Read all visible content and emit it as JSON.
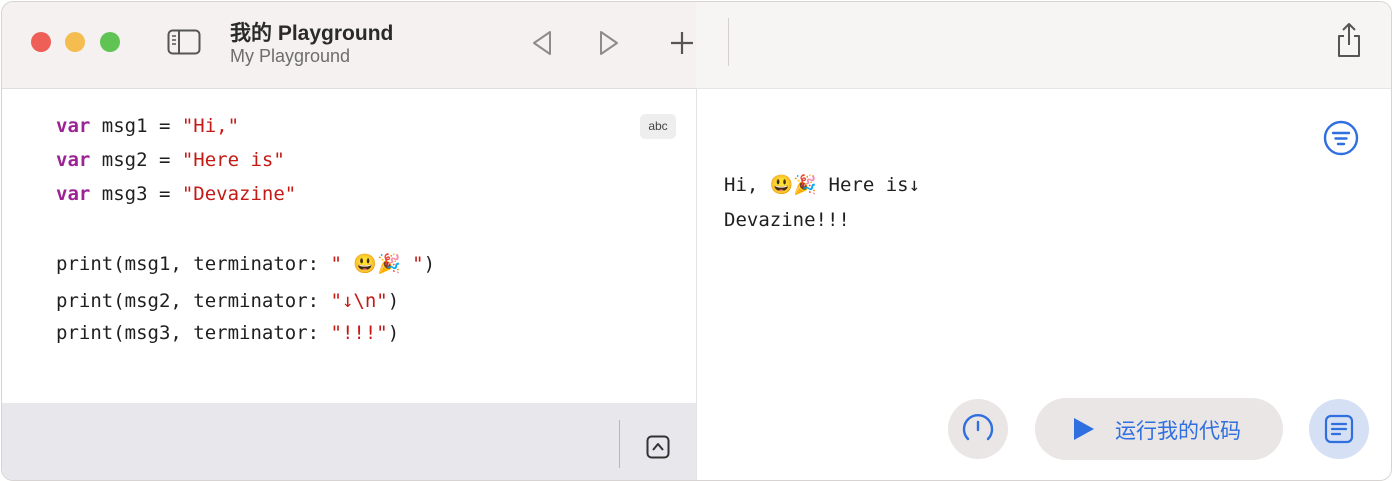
{
  "window": {
    "title": "我的 Playground",
    "subtitle": "My Playground"
  },
  "toolbar": {
    "icons": [
      "sidebar-toggle-icon",
      "back-arrow-icon",
      "forward-arrow-icon",
      "plus-icon",
      "share-icon"
    ]
  },
  "editor": {
    "badge": "abc",
    "lines": [
      {
        "keyword": "var",
        "rest": " msg1 = ",
        "string": "\"Hi,\""
      },
      {
        "keyword": "var",
        "rest": " msg2 = ",
        "string": "\"Here is\""
      },
      {
        "keyword": "var",
        "rest": " msg3 = ",
        "string": "\"Devazine\""
      },
      {
        "code": "print(msg1, terminator: ",
        "string": "\" 😃🎉 \"",
        "close": ")"
      },
      {
        "code": "print(msg2, terminator: ",
        "string": "\"↓\\n\"",
        "close": ")"
      },
      {
        "code": "print(msg3, terminator: ",
        "string": "\"!!!\"",
        "close": ")"
      }
    ]
  },
  "output": {
    "lines": [
      "Hi, 😃🎉 Here is↓",
      "Devazine!!!"
    ]
  },
  "controls": {
    "run_label": "运行我的代码"
  },
  "colors": {
    "keyword": "#9b2393",
    "string": "#c41a16",
    "accent": "#2f6fe0"
  }
}
